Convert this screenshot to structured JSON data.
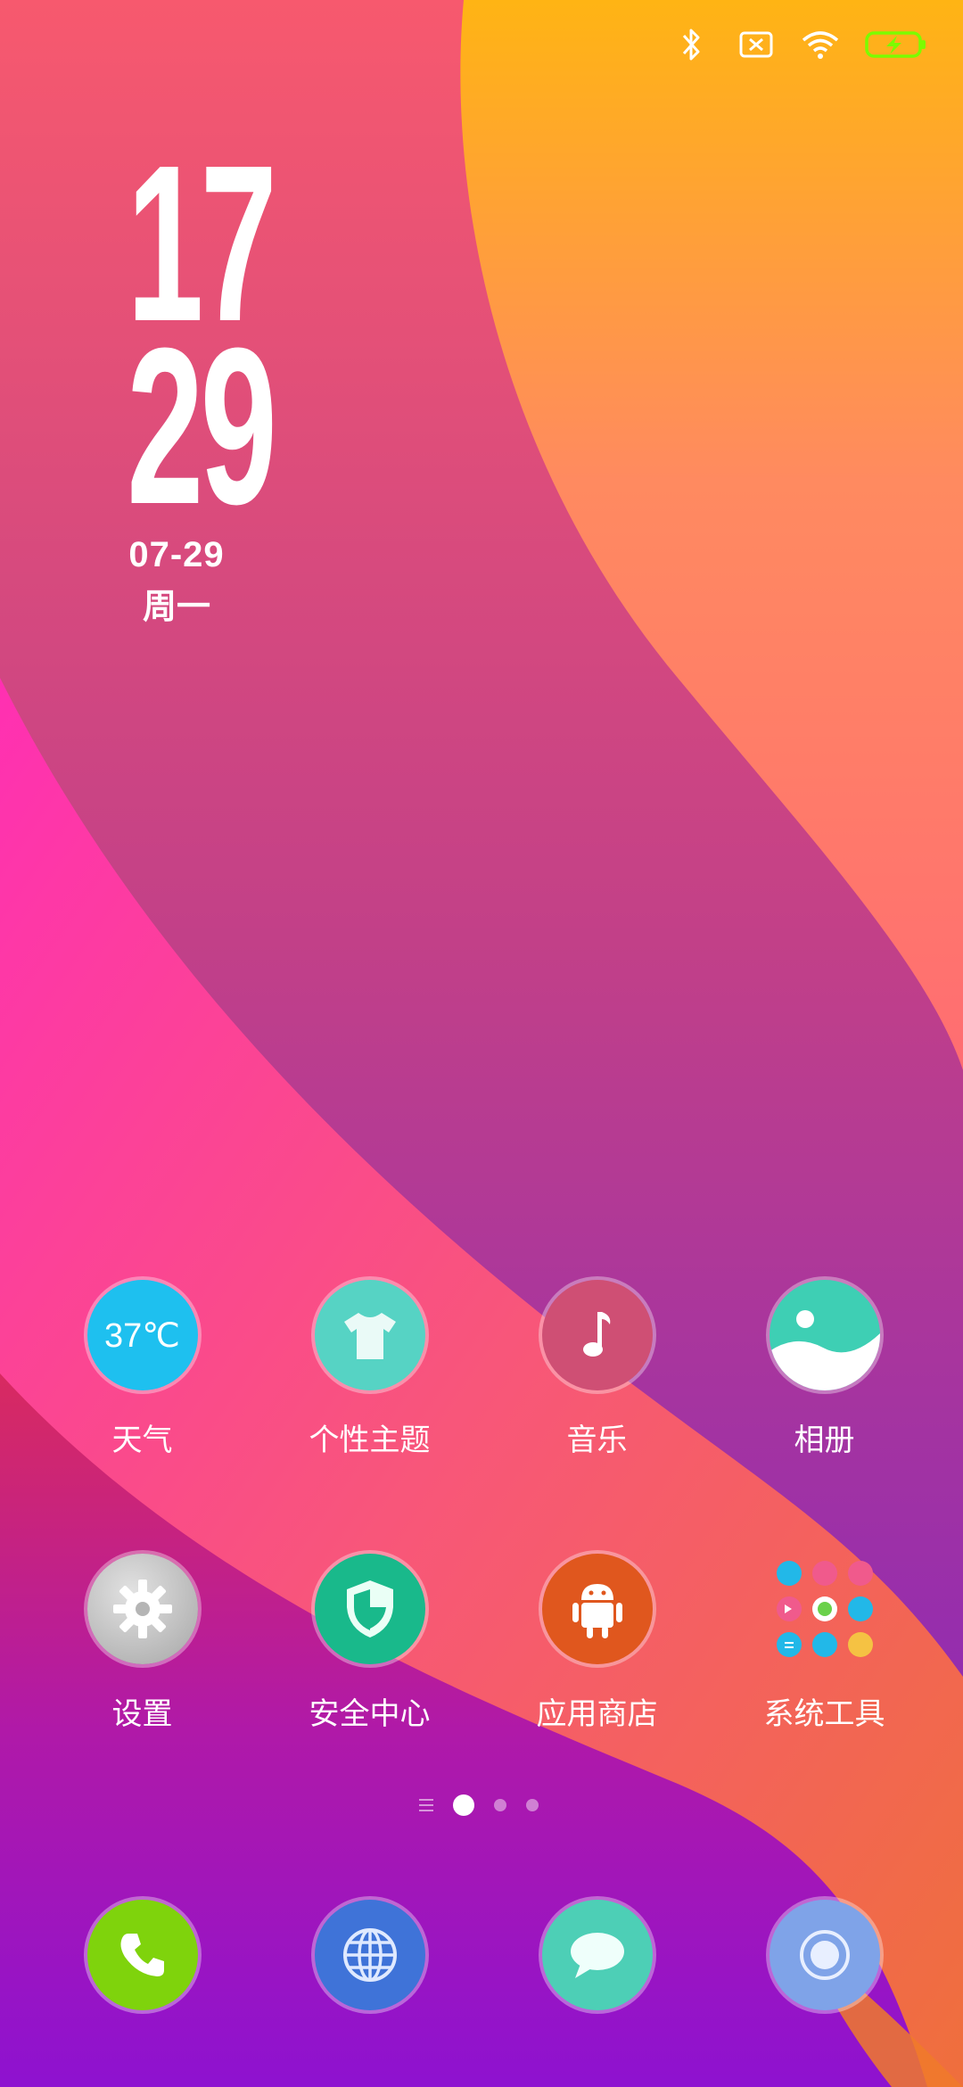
{
  "status_bar": {
    "icons": [
      "bluetooth-icon",
      "no-sim-icon",
      "wifi-icon",
      "battery-charging-icon"
    ],
    "accent": "#7CFC00"
  },
  "clock_widget": {
    "hour": "17",
    "minute": "29",
    "date": "07-29",
    "weekday": "周一"
  },
  "home_row_1": [
    {
      "label": "天气",
      "icon": "weather-icon",
      "badge_text": "37℃",
      "color": "#1ec0ef"
    },
    {
      "label": "个性主题",
      "icon": "tshirt-icon",
      "color": "#56d3c4"
    },
    {
      "label": "音乐",
      "icon": "music-note-icon",
      "color": "#cf4f74"
    },
    {
      "label": "相册",
      "icon": "gallery-icon",
      "color": "#3ecfb4"
    }
  ],
  "home_row_2": [
    {
      "label": "设置",
      "icon": "gear-icon",
      "color": "#b9b9b9"
    },
    {
      "label": "安全中心",
      "icon": "shield-icon",
      "color": "#19b98b"
    },
    {
      "label": "应用商店",
      "icon": "android-icon",
      "color": "#e0571e"
    },
    {
      "label": "系统工具",
      "icon": "folder-icon",
      "color": "#f3f3f3"
    }
  ],
  "page_indicator": {
    "pages": 3,
    "current": 1
  },
  "dock": [
    {
      "name": "phone",
      "icon": "phone-icon",
      "color": "#7fd30c"
    },
    {
      "name": "browser",
      "icon": "globe-icon",
      "color": "#3f73d8"
    },
    {
      "name": "messages",
      "icon": "chat-bubble-icon",
      "color": "#4dcfb6"
    },
    {
      "name": "camera",
      "icon": "camera-icon",
      "color": "#7fa3e8"
    }
  ]
}
